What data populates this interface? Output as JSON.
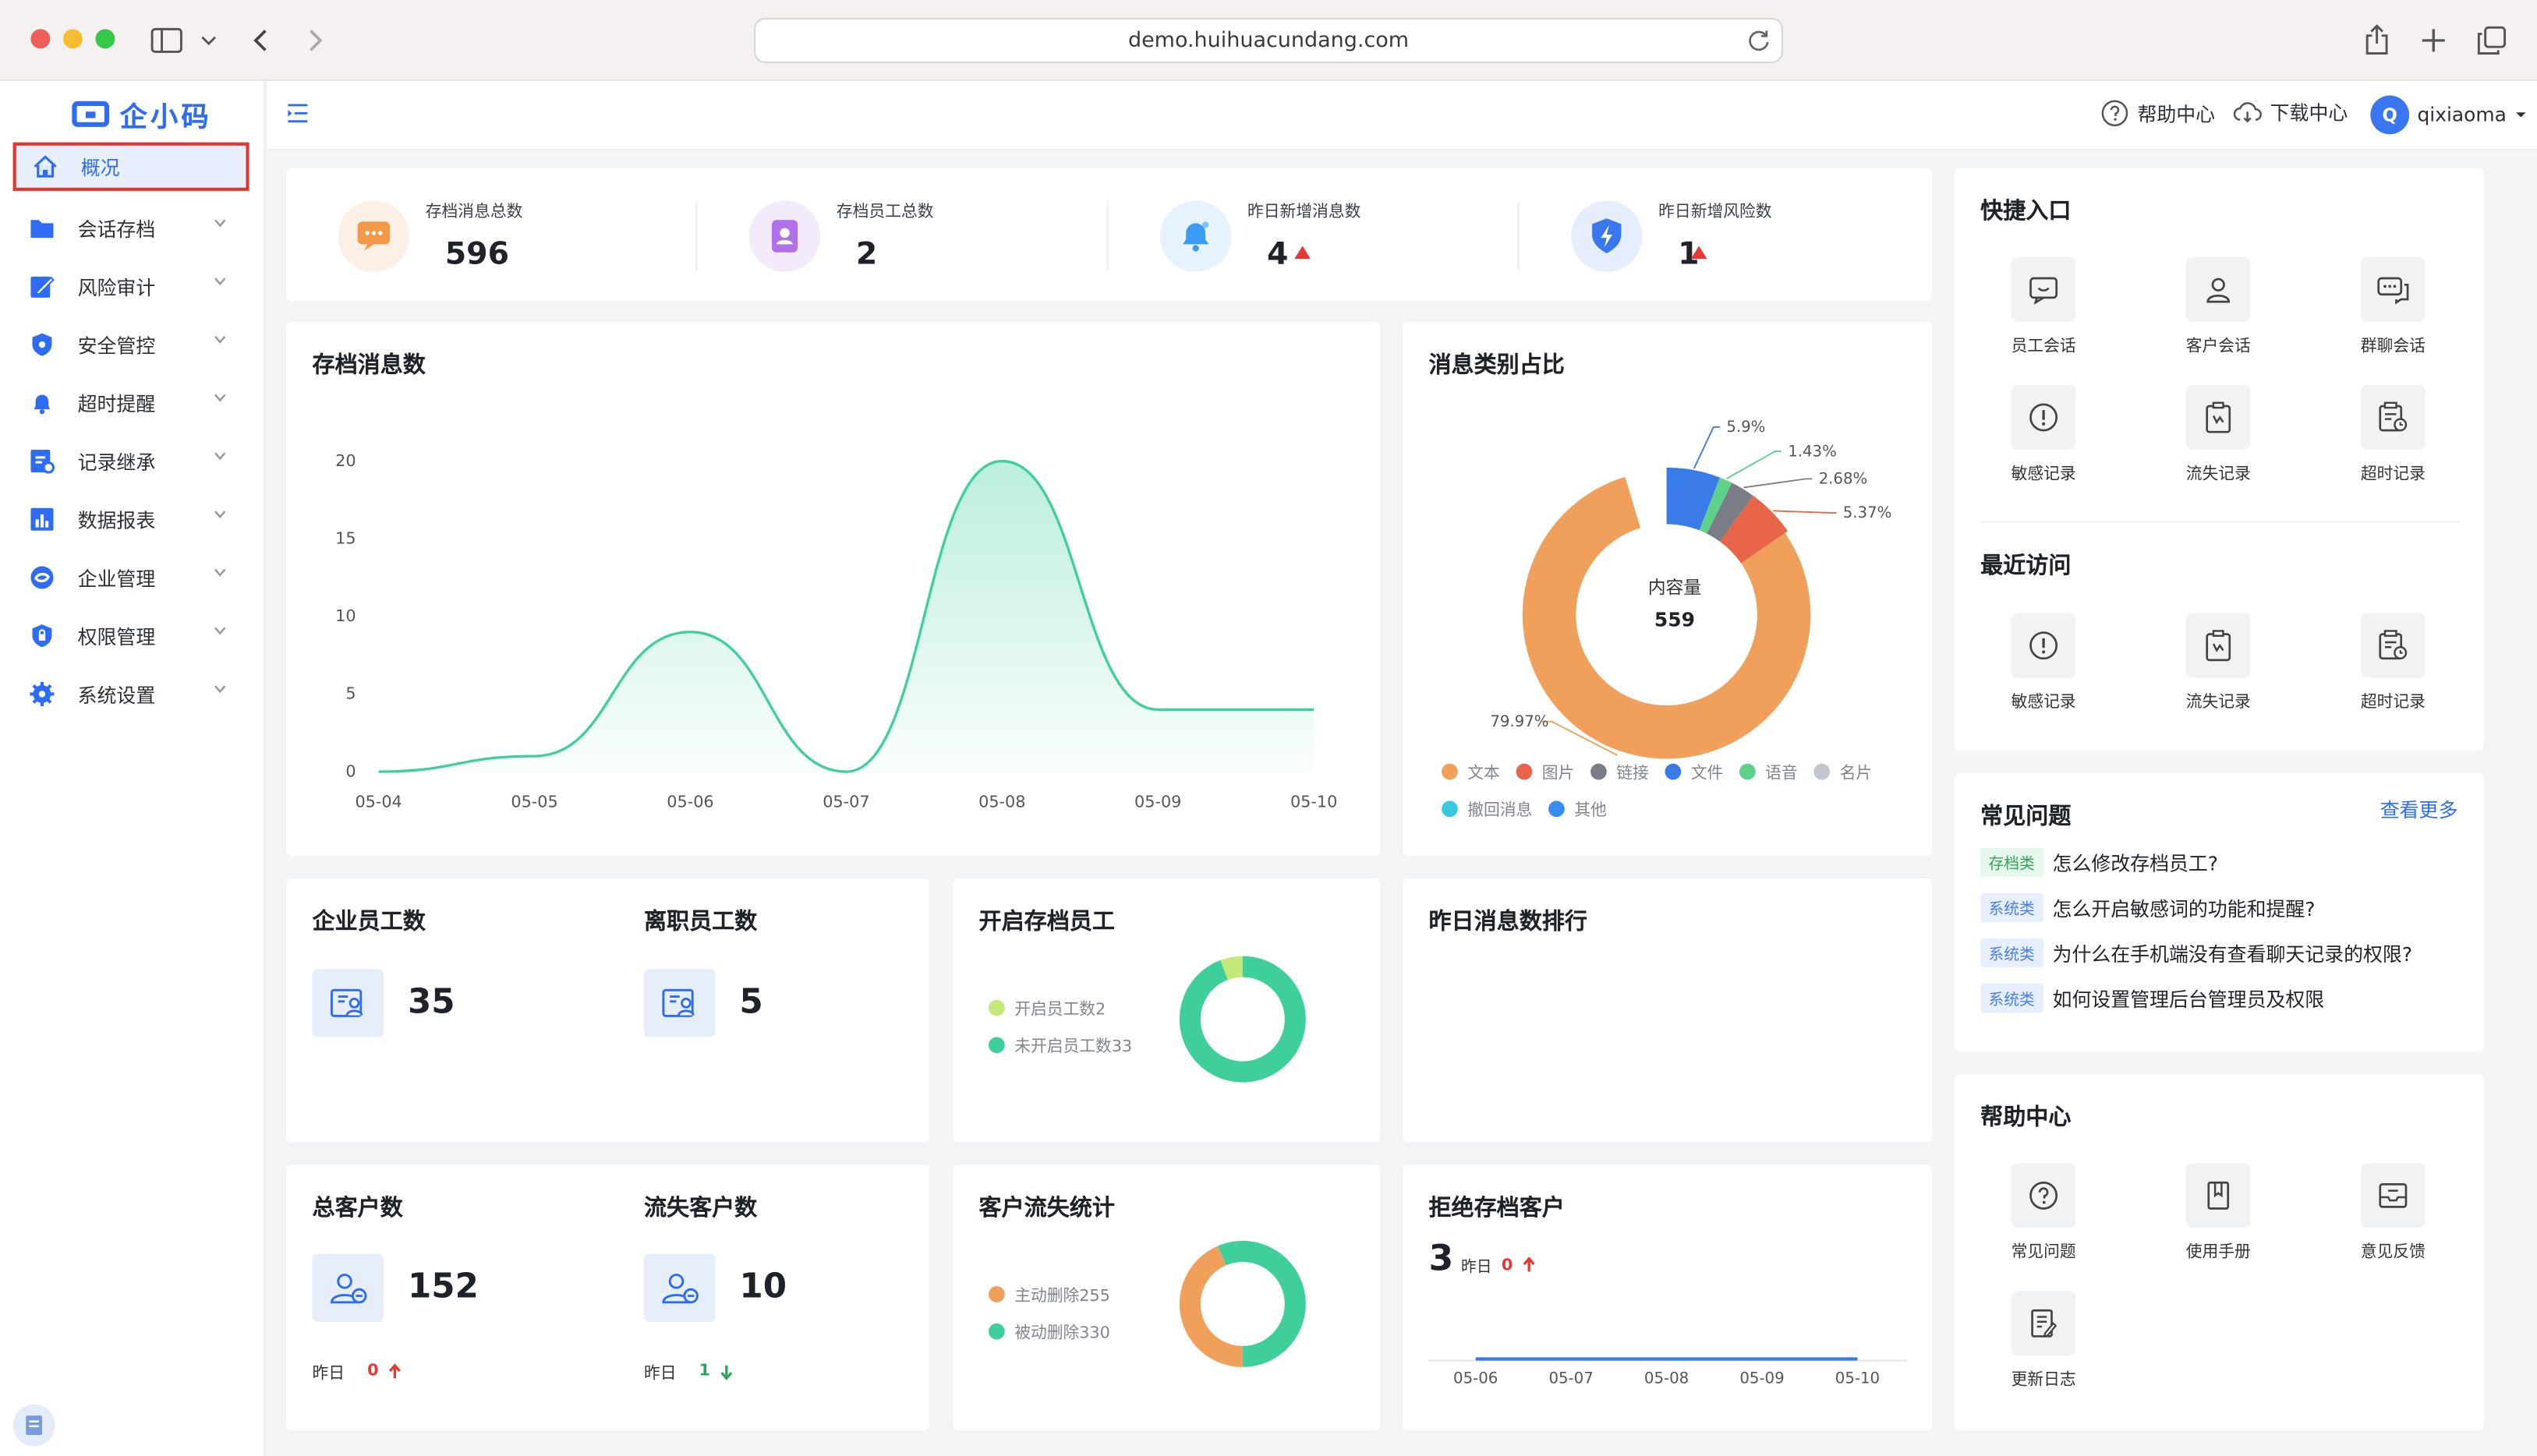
{
  "browser": {
    "url": "demo.huihuacundang.com"
  },
  "brand": {
    "logo_text": "企小码"
  },
  "sidebar": {
    "items": [
      {
        "label": "概况",
        "icon": "home-icon"
      },
      {
        "label": "会话存档",
        "icon": "folder-icon"
      },
      {
        "label": "风险审计",
        "icon": "edit-icon"
      },
      {
        "label": "安全管控",
        "icon": "shield-icon"
      },
      {
        "label": "超时提醒",
        "icon": "bell-icon"
      },
      {
        "label": "记录继承",
        "icon": "inherit-icon"
      },
      {
        "label": "数据报表",
        "icon": "bar-chart-icon"
      },
      {
        "label": "企业管理",
        "icon": "enterprise-icon"
      },
      {
        "label": "权限管理",
        "icon": "permission-icon"
      },
      {
        "label": "系统设置",
        "icon": "gear-icon"
      }
    ]
  },
  "topbar": {
    "help": "帮助中心",
    "download": "下载中心",
    "avatar_letter": "Q",
    "username": "qixiaoma"
  },
  "stats": [
    {
      "label": "存档消息总数",
      "value": "596",
      "trend": "",
      "icon": "message-icon",
      "color": "#f2994a"
    },
    {
      "label": "存档员工总数",
      "value": "2",
      "trend": "",
      "icon": "contact-icon",
      "color": "#b070e8"
    },
    {
      "label": "昨日新增消息数",
      "value": "4",
      "trend": "up",
      "icon": "bell-icon",
      "color": "#3a9cf5"
    },
    {
      "label": "昨日新增风险数",
      "value": "1",
      "trend": "up",
      "icon": "lightning-shield-icon",
      "color": "#3a76f0"
    }
  ],
  "archive_chart": {
    "title": "存档消息数",
    "chart_data": {
      "type": "area",
      "x": [
        "05-04",
        "05-05",
        "05-06",
        "05-07",
        "05-08",
        "05-09",
        "05-10"
      ],
      "y": [
        0,
        1,
        9,
        0,
        20,
        4,
        4
      ],
      "yticks": [
        0,
        5,
        10,
        15,
        20
      ],
      "ylim": [
        0,
        20
      ],
      "smooth": true,
      "color": "#3ecf9a"
    }
  },
  "category_chart": {
    "title": "消息类别占比",
    "center_label": "内容量",
    "center_value": "559",
    "chart_data": {
      "type": "pie",
      "donut": true,
      "slices": [
        {
          "name": "文本",
          "percent": 79.97,
          "label": "79.97%",
          "color": "#f0a05a"
        },
        {
          "name": "图片",
          "percent": 5.37,
          "label": "5.37%",
          "color": "#e8654a"
        },
        {
          "name": "链接",
          "percent": 2.68,
          "label": "2.68%",
          "color": "#7a7d85"
        },
        {
          "name": "文件",
          "percent": 5.9,
          "label": "5.9%",
          "color": "#3a7be8"
        },
        {
          "name": "语音",
          "percent": 1.43,
          "label": "1.43%",
          "color": "#5ed18b"
        },
        {
          "name": "名片",
          "percent": 0,
          "label": "",
          "color": "#c2c6cc"
        },
        {
          "name": "撤回消息",
          "percent": 0,
          "label": "",
          "color": "#3ac7e0"
        },
        {
          "name": "其他",
          "percent": 0,
          "label": "",
          "color": "#3a8cf5"
        }
      ]
    }
  },
  "quick": {
    "title": "快捷入口",
    "items": [
      {
        "label": "员工会话",
        "icon": "employee-chat-icon"
      },
      {
        "label": "客户会话",
        "icon": "customer-icon"
      },
      {
        "label": "群聊会话",
        "icon": "group-chat-icon"
      },
      {
        "label": "敏感记录",
        "icon": "alert-icon"
      },
      {
        "label": "流失记录",
        "icon": "clipboard-icon"
      },
      {
        "label": "超时记录",
        "icon": "timer-doc-icon"
      }
    ]
  },
  "recent": {
    "title": "最近访问",
    "items": [
      {
        "label": "敏感记录",
        "icon": "alert-icon"
      },
      {
        "label": "流失记录",
        "icon": "clipboard-icon"
      },
      {
        "label": "超时记录",
        "icon": "timer-doc-icon"
      }
    ]
  },
  "faq": {
    "title": "常见问题",
    "more": "查看更多",
    "items": [
      {
        "tag": "存档类",
        "text": "怎么修改存档员工?",
        "tag_color": "green"
      },
      {
        "tag": "系统类",
        "text": "怎么开启敏感词的功能和提醒?",
        "tag_color": "blue"
      },
      {
        "tag": "系统类",
        "text": "为什么在手机端没有查看聊天记录的权限?",
        "tag_color": "blue"
      },
      {
        "tag": "系统类",
        "text": "如何设置管理后台管理员及权限",
        "tag_color": "blue"
      }
    ]
  },
  "help_center": {
    "title": "帮助中心",
    "items": [
      {
        "label": "常见问题",
        "icon": "question-icon"
      },
      {
        "label": "使用手册",
        "icon": "bookmark-icon"
      },
      {
        "label": "意见反馈",
        "icon": "feedback-icon"
      },
      {
        "label": "更新日志",
        "icon": "log-icon"
      }
    ]
  },
  "employees": {
    "total_label": "企业员工数",
    "total_value": "35",
    "left_label": "离职员工数",
    "left_value": "5"
  },
  "archive_staff": {
    "title": "开启存档员工",
    "chart_data": {
      "type": "pie",
      "donut": true,
      "slices": [
        {
          "name": "开启员工数2",
          "value": 2,
          "color": "#c5e87a"
        },
        {
          "name": "未开启员工数33",
          "value": 33,
          "color": "#3ecf9a"
        }
      ]
    }
  },
  "yesterday_rank": {
    "title": "昨日消息数排行"
  },
  "customers": {
    "total_label": "总客户数",
    "total_value": "152",
    "total_yday_label": "昨日",
    "total_yday_value": "0",
    "lost_label": "流失客户数",
    "lost_value": "10",
    "lost_yday_label": "昨日",
    "lost_yday_value": "1"
  },
  "customer_loss": {
    "title": "客户流失统计",
    "chart_data": {
      "type": "pie",
      "donut": true,
      "slices": [
        {
          "name": "主动删除255",
          "value": 255,
          "color": "#f0a05a"
        },
        {
          "name": "被动删除330",
          "value": 330,
          "color": "#3ecf9a"
        }
      ]
    }
  },
  "rejected": {
    "title": "拒绝存档客户",
    "value": "3",
    "yday_label": "昨日",
    "yday_value": "0",
    "chart_data": {
      "type": "line",
      "x": [
        "05-06",
        "05-07",
        "05-08",
        "05-09",
        "05-10"
      ],
      "y": [
        0,
        0,
        0,
        0,
        0
      ],
      "color": "#3a7be8"
    }
  }
}
